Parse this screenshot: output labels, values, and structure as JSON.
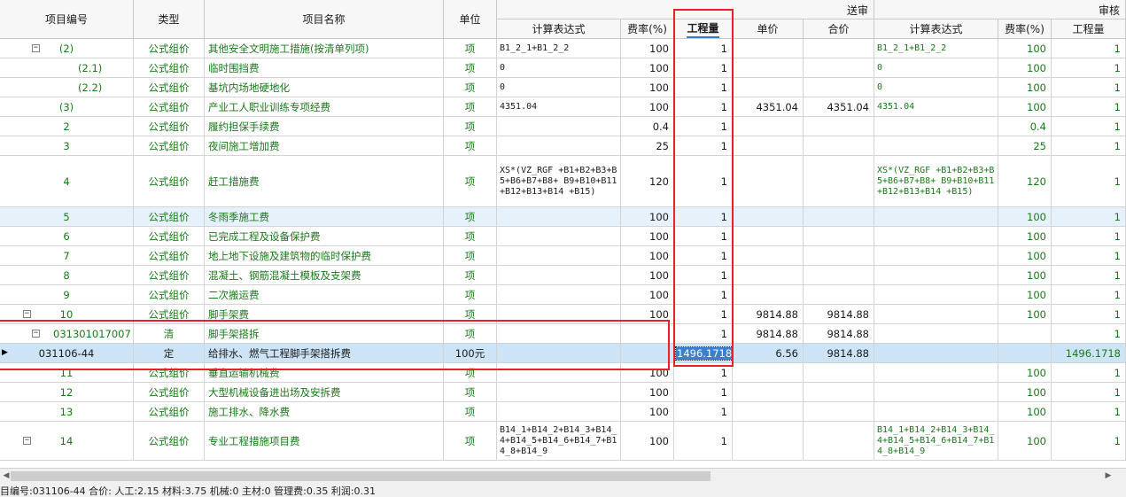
{
  "header": {
    "group_send": "送审",
    "group_audit": "审核",
    "col_code": "项目编号",
    "col_type": "类型",
    "col_name": "项目名称",
    "col_unit": "单位",
    "col_expr": "计算表达式",
    "col_rate": "费率(%)",
    "col_qty": "工程量",
    "col_price": "单价",
    "col_total": "合价",
    "col_expr2": "计算表达式",
    "col_rate2": "费率(%)",
    "col_qty2": "工程量"
  },
  "rows": [
    {
      "code": "(2)",
      "type": "公式组价",
      "name": "其他安全文明施工措施(按清单列项)",
      "unit": "项",
      "expr": "B1_2_1+B1_2_2",
      "rate": "100",
      "qty": "1",
      "price": "",
      "total": "",
      "expr2": "B1_2_1+B1_2_2",
      "rate2": "100",
      "qty2": "1"
    },
    {
      "code": "(2.1)",
      "type": "公式组价",
      "name": "临时围挡费",
      "unit": "项",
      "expr": "0",
      "rate": "100",
      "qty": "1",
      "price": "",
      "total": "",
      "expr2": "0",
      "rate2": "100",
      "qty2": "1"
    },
    {
      "code": "(2.2)",
      "type": "公式组价",
      "name": "基坑内场地硬地化",
      "unit": "项",
      "expr": "0",
      "rate": "100",
      "qty": "1",
      "price": "",
      "total": "",
      "expr2": "0",
      "rate2": "100",
      "qty2": "1"
    },
    {
      "code": "(3)",
      "type": "公式组价",
      "name": "产业工人职业训练专项经费",
      "unit": "项",
      "expr": "4351.04",
      "rate": "100",
      "qty": "1",
      "price": "4351.04",
      "total": "4351.04",
      "expr2": "4351.04",
      "rate2": "100",
      "qty2": "1"
    },
    {
      "code": "2",
      "type": "公式组价",
      "name": "履约担保手续费",
      "unit": "项",
      "expr": "",
      "rate": "0.4",
      "qty": "1",
      "price": "",
      "total": "",
      "expr2": "",
      "rate2": "0.4",
      "qty2": "1"
    },
    {
      "code": "3",
      "type": "公式组价",
      "name": "夜间施工增加费",
      "unit": "项",
      "expr": "",
      "rate": "25",
      "qty": "1",
      "price": "",
      "total": "",
      "expr2": "",
      "rate2": "25",
      "qty2": "1"
    },
    {
      "code": "4",
      "type": "公式组价",
      "name": "赶工措施费",
      "unit": "项",
      "expr": "XS*(VZ_RGF +B1+B2+B3+B5+B6+B7+B8+ B9+B10+B11+B12+B13+B14 +B15)",
      "rate": "120",
      "qty": "1",
      "price": "",
      "total": "",
      "expr2": "XS*(VZ_RGF +B1+B2+B3+B5+B6+B7+B8+ B9+B10+B11+B12+B13+B14 +B15)",
      "rate2": "120",
      "qty2": "1"
    },
    {
      "code": "5",
      "type": "公式组价",
      "name": "冬雨季施工费",
      "unit": "项",
      "expr": "",
      "rate": "100",
      "qty": "1",
      "price": "",
      "total": "",
      "expr2": "",
      "rate2": "100",
      "qty2": "1"
    },
    {
      "code": "6",
      "type": "公式组价",
      "name": "已完成工程及设备保护费",
      "unit": "项",
      "expr": "",
      "rate": "100",
      "qty": "1",
      "price": "",
      "total": "",
      "expr2": "",
      "rate2": "100",
      "qty2": "1"
    },
    {
      "code": "7",
      "type": "公式组价",
      "name": "地上地下设施及建筑物的临时保护费",
      "unit": "项",
      "expr": "",
      "rate": "100",
      "qty": "1",
      "price": "",
      "total": "",
      "expr2": "",
      "rate2": "100",
      "qty2": "1"
    },
    {
      "code": "8",
      "type": "公式组价",
      "name": "混凝土、钢筋混凝土模板及支架费",
      "unit": "项",
      "expr": "",
      "rate": "100",
      "qty": "1",
      "price": "",
      "total": "",
      "expr2": "",
      "rate2": "100",
      "qty2": "1"
    },
    {
      "code": "9",
      "type": "公式组价",
      "name": "二次搬运费",
      "unit": "项",
      "expr": "",
      "rate": "100",
      "qty": "1",
      "price": "",
      "total": "",
      "expr2": "",
      "rate2": "100",
      "qty2": "1"
    },
    {
      "code": "10",
      "type": "公式组价",
      "name": "脚手架费",
      "unit": "项",
      "expr": "",
      "rate": "100",
      "qty": "1",
      "price": "9814.88",
      "total": "9814.88",
      "expr2": "",
      "rate2": "100",
      "qty2": "1"
    },
    {
      "code": "031301017007",
      "type": "清",
      "name": "脚手架搭拆",
      "unit": "项",
      "expr": "",
      "rate": "",
      "qty": "1",
      "price": "9814.88",
      "total": "9814.88",
      "expr2": "",
      "rate2": "",
      "qty2": "1"
    },
    {
      "code": "031106-44",
      "type": "定",
      "name": "给排水、燃气工程脚手架搭拆费",
      "unit": "100元",
      "expr": "",
      "rate": "",
      "qty": "1496.1718",
      "price": "6.56",
      "total": "9814.88",
      "expr2": "",
      "rate2": "",
      "qty2": "1496.1718"
    },
    {
      "code": "11",
      "type": "公式组价",
      "name": "垂直运输机械费",
      "unit": "项",
      "expr": "",
      "rate": "100",
      "qty": "1",
      "price": "",
      "total": "",
      "expr2": "",
      "rate2": "100",
      "qty2": "1"
    },
    {
      "code": "12",
      "type": "公式组价",
      "name": "大型机械设备进出场及安拆费",
      "unit": "项",
      "expr": "",
      "rate": "100",
      "qty": "1",
      "price": "",
      "total": "",
      "expr2": "",
      "rate2": "100",
      "qty2": "1"
    },
    {
      "code": "13",
      "type": "公式组价",
      "name": "施工排水、降水费",
      "unit": "项",
      "expr": "",
      "rate": "100",
      "qty": "1",
      "price": "",
      "total": "",
      "expr2": "",
      "rate2": "100",
      "qty2": "1"
    },
    {
      "code": "14",
      "type": "公式组价",
      "name": "专业工程措施项目费",
      "unit": "项",
      "expr": "B14_1+B14_2+B14_3+B14_ 4+B14_5+B14_6+B14_7+B1 4_8+B14_9",
      "rate": "100",
      "qty": "1",
      "price": "",
      "total": "",
      "expr2": "B14_1+B14_2+B14_3+B14_ 4+B14_5+B14_6+B14_7+B1 4_8+B14_9",
      "rate2": "100",
      "qty2": "1"
    }
  ],
  "status_bar": "目编号:031106-44   合价:   人工:2.15   材料:3.75   机械:0   主材:0   管理费:0.35   利润:0.31",
  "colors": {
    "green_text": "#1a7a1a",
    "selected_row": "#cde4f7",
    "highlight_row": "#e6f1fb",
    "annotation_red": "#e8202a"
  }
}
